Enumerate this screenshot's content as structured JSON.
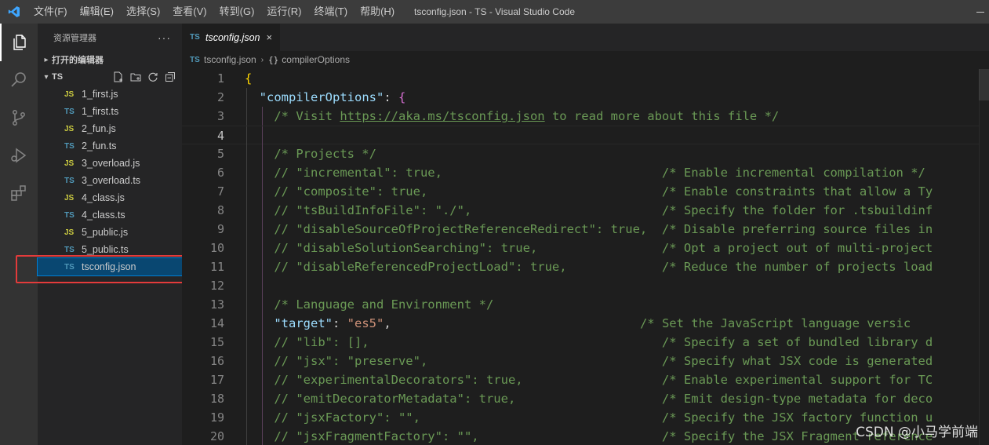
{
  "titlebar": {
    "title": "tsconfig.json - TS - Visual Studio Code",
    "menu": [
      "文件(F)",
      "编辑(E)",
      "选择(S)",
      "查看(V)",
      "转到(G)",
      "运行(R)",
      "终端(T)",
      "帮助(H)"
    ]
  },
  "activitybar": {
    "icons": [
      "explorer-icon",
      "search-icon",
      "source-control-icon",
      "run-debug-icon",
      "extensions-icon"
    ]
  },
  "sidebar": {
    "title": "资源管理器",
    "more": "···",
    "open_editors": "打开的编辑器",
    "folder": "TS",
    "files": [
      {
        "name": "1_first.js",
        "type": "JS"
      },
      {
        "name": "1_first.ts",
        "type": "TS"
      },
      {
        "name": "2_fun.js",
        "type": "JS"
      },
      {
        "name": "2_fun.ts",
        "type": "TS"
      },
      {
        "name": "3_overload.js",
        "type": "JS"
      },
      {
        "name": "3_overload.ts",
        "type": "TS"
      },
      {
        "name": "4_class.js",
        "type": "JS"
      },
      {
        "name": "4_class.ts",
        "type": "TS"
      },
      {
        "name": "5_public.js",
        "type": "JS"
      },
      {
        "name": "5_public.ts",
        "type": "TS"
      },
      {
        "name": "tsconfig.json",
        "type": "TS"
      }
    ]
  },
  "editor": {
    "tab": {
      "label": "tsconfig.json",
      "icon": "TS",
      "close": "×"
    },
    "breadcrumb": {
      "file": "tsconfig.json",
      "symbol": "compilerOptions",
      "symbol_icon": "{}"
    },
    "lines": [
      {
        "n": "1",
        "parts": [
          [
            "c-bracket1",
            "{"
          ]
        ]
      },
      {
        "n": "2",
        "parts": [
          [
            "c-punc",
            "  "
          ],
          [
            "c-key",
            "\"compilerOptions\""
          ],
          [
            "c-punc",
            ": "
          ],
          [
            "c-bracket2",
            "{"
          ]
        ]
      },
      {
        "n": "3",
        "parts": [
          [
            "c-punc",
            "    "
          ],
          [
            "c-comment",
            "/* Visit "
          ],
          [
            "c-link",
            "https://aka.ms/tsconfig.json"
          ],
          [
            "c-comment",
            " to read more about this file */"
          ]
        ]
      },
      {
        "n": "4",
        "parts": []
      },
      {
        "n": "5",
        "parts": [
          [
            "c-punc",
            "    "
          ],
          [
            "c-comment",
            "/* Projects */"
          ]
        ]
      },
      {
        "n": "6",
        "parts": [
          [
            "c-punc",
            "    "
          ],
          [
            "c-comment",
            "// \"incremental\": true,                              /* Enable incremental compilation */"
          ]
        ]
      },
      {
        "n": "7",
        "parts": [
          [
            "c-punc",
            "    "
          ],
          [
            "c-comment",
            "// \"composite\": true,                                /* Enable constraints that allow a Ty"
          ]
        ]
      },
      {
        "n": "8",
        "parts": [
          [
            "c-punc",
            "    "
          ],
          [
            "c-comment",
            "// \"tsBuildInfoFile\": \"./\",                          /* Specify the folder for .tsbuildinf"
          ]
        ]
      },
      {
        "n": "9",
        "parts": [
          [
            "c-punc",
            "    "
          ],
          [
            "c-comment",
            "// \"disableSourceOfProjectReferenceRedirect\": true,  /* Disable preferring source files in"
          ]
        ]
      },
      {
        "n": "10",
        "parts": [
          [
            "c-punc",
            "    "
          ],
          [
            "c-comment",
            "// \"disableSolutionSearching\": true,                 /* Opt a project out of multi-project"
          ]
        ]
      },
      {
        "n": "11",
        "parts": [
          [
            "c-punc",
            "    "
          ],
          [
            "c-comment",
            "// \"disableReferencedProjectLoad\": true,             /* Reduce the number of projects load"
          ]
        ]
      },
      {
        "n": "12",
        "parts": []
      },
      {
        "n": "13",
        "parts": [
          [
            "c-punc",
            "    "
          ],
          [
            "c-comment",
            "/* Language and Environment */"
          ]
        ]
      },
      {
        "n": "14",
        "parts": [
          [
            "c-punc",
            "    "
          ],
          [
            "c-key",
            "\"target\""
          ],
          [
            "c-punc",
            ": "
          ],
          [
            "c-str",
            "\"es5\""
          ],
          [
            "c-punc",
            ",                                  "
          ],
          [
            "c-comment",
            "/* Set the JavaScript language versic"
          ]
        ]
      },
      {
        "n": "15",
        "parts": [
          [
            "c-punc",
            "    "
          ],
          [
            "c-comment",
            "// \"lib\": [],                                        /* Specify a set of bundled library d"
          ]
        ]
      },
      {
        "n": "16",
        "parts": [
          [
            "c-punc",
            "    "
          ],
          [
            "c-comment",
            "// \"jsx\": \"preserve\",                                /* Specify what JSX code is generated"
          ]
        ]
      },
      {
        "n": "17",
        "parts": [
          [
            "c-punc",
            "    "
          ],
          [
            "c-comment",
            "// \"experimentalDecorators\": true,                   /* Enable experimental support for TC"
          ]
        ]
      },
      {
        "n": "18",
        "parts": [
          [
            "c-punc",
            "    "
          ],
          [
            "c-comment",
            "// \"emitDecoratorMetadata\": true,                    /* Emit design-type metadata for deco"
          ]
        ]
      },
      {
        "n": "19",
        "parts": [
          [
            "c-punc",
            "    "
          ],
          [
            "c-comment",
            "// \"jsxFactory\": \"\",                                 /* Specify the JSX factory function u"
          ]
        ]
      },
      {
        "n": "20",
        "parts": [
          [
            "c-punc",
            "    "
          ],
          [
            "c-comment",
            "// \"jsxFragmentFactory\": \"\",                         /* Specify the JSX Fragment reference"
          ]
        ]
      }
    ]
  },
  "watermark": "CSDN @小马学前端",
  "colors": {
    "accent": "#007acc",
    "highlight": "#e33b3b",
    "selection": "#094771"
  }
}
